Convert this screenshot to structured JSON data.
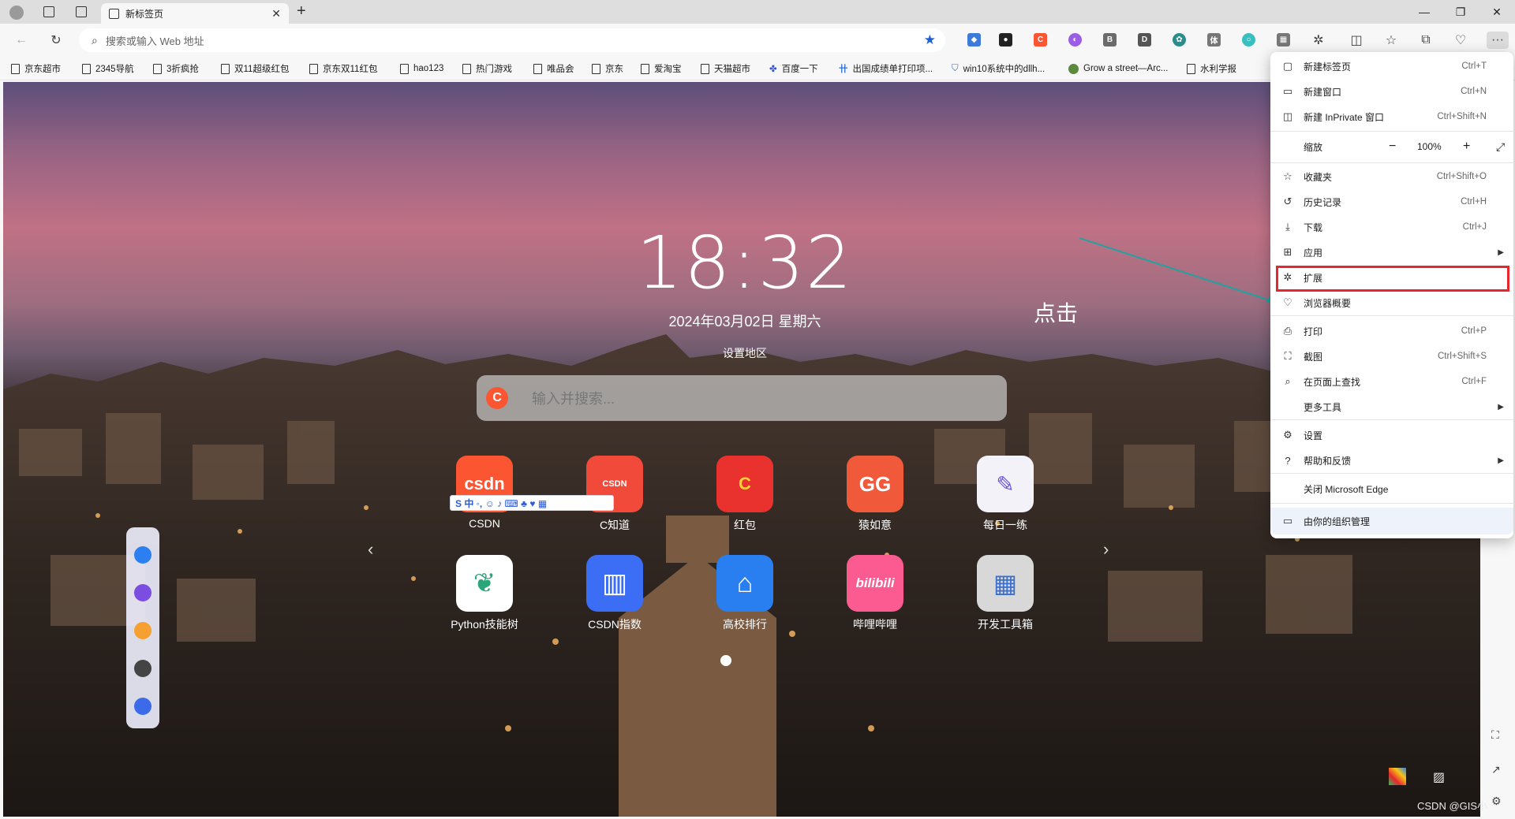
{
  "tab": {
    "title": "新标签页"
  },
  "address": {
    "placeholder": "搜索或输入 Web 地址"
  },
  "favorites": [
    "京东超市",
    "2345导航",
    "3折疯抢",
    "双11超级红包",
    "京东双11红包",
    "hao123",
    "热门游戏",
    "唯品会",
    "京东",
    "爱淘宝",
    "天猫超市",
    "百度一下",
    "出国成绩单打印项...",
    "win10系统中的dllh...",
    "Grow a street—Arc...",
    "水利学报"
  ],
  "extensions": [
    {
      "label": "C",
      "color": "#fc5531"
    },
    {
      "label": "B",
      "color": "#6b6b6b"
    },
    {
      "label": "D",
      "color": "#555555"
    },
    {
      "label": "体",
      "color": "#777777"
    }
  ],
  "ntp": {
    "time": "18:32",
    "date": "2024年03月02日   星期六",
    "region": "设置地区",
    "search_placeholder": "输入并搜索...",
    "search_logo": "C",
    "apps": [
      {
        "label": "CSDN",
        "icon_text": "csdn",
        "color": "#fc5531"
      },
      {
        "label": "C知道",
        "icon_text": "CSDN",
        "color": "#f24a3a"
      },
      {
        "label": "红包",
        "icon_text": "C",
        "color": "#e9322e"
      },
      {
        "label": "猿如意",
        "icon_text": "GG",
        "color": "#f05a3a"
      },
      {
        "label": "每日一练",
        "icon_text": "✎",
        "color": "#f2f2f8"
      },
      {
        "label": "Python技能树",
        "icon_text": "❦",
        "color": "#ffffff"
      },
      {
        "label": "CSDN指数",
        "icon_text": "▥",
        "color": "#3b6df5"
      },
      {
        "label": "高校排行",
        "icon_text": "⌂",
        "color": "#2a7ff0"
      },
      {
        "label": "哔哩哔哩",
        "icon_text": "bilibili",
        "color": "#fb5b91"
      },
      {
        "label": "开发工具箱",
        "icon_text": "▦",
        "color": "#d8d8d8"
      }
    ],
    "ime_bar": "S 中 ◦, ☺ ♪ ⌨ ♣ ♥ ▦"
  },
  "menu": {
    "items": [
      {
        "label": "新建标签页",
        "shortcut": "Ctrl+T",
        "icon": "new-tab-icon",
        "glyph": "▢"
      },
      {
        "label": "新建窗口",
        "shortcut": "Ctrl+N",
        "icon": "new-window-icon",
        "glyph": "▭"
      },
      {
        "label": "新建 InPrivate 窗口",
        "shortcut": "Ctrl+Shift+N",
        "icon": "inprivate-icon",
        "glyph": "◫"
      },
      {
        "label": "缩放",
        "shortcut": "",
        "icon": "zoom-icon",
        "glyph": ""
      },
      {
        "label": "收藏夹",
        "shortcut": "Ctrl+Shift+O",
        "icon": "favorites-icon",
        "glyph": "☆"
      },
      {
        "label": "历史记录",
        "shortcut": "Ctrl+H",
        "icon": "history-icon",
        "glyph": "↺"
      },
      {
        "label": "下载",
        "shortcut": "Ctrl+J",
        "icon": "download-icon",
        "glyph": "⤓"
      },
      {
        "label": "应用",
        "shortcut": "",
        "icon": "apps-icon",
        "glyph": "⊞"
      },
      {
        "label": "扩展",
        "shortcut": "",
        "icon": "extensions-icon",
        "glyph": "✲"
      },
      {
        "label": "浏览器概要",
        "shortcut": "",
        "icon": "browser-essentials-icon",
        "glyph": "♡"
      },
      {
        "label": "打印",
        "shortcut": "Ctrl+P",
        "icon": "print-icon",
        "glyph": "⎙"
      },
      {
        "label": "截图",
        "shortcut": "Ctrl+Shift+S",
        "icon": "screenshot-icon",
        "glyph": "⛶"
      },
      {
        "label": "在页面上查找",
        "shortcut": "Ctrl+F",
        "icon": "find-icon",
        "glyph": "⌕"
      },
      {
        "label": "更多工具",
        "shortcut": "",
        "icon": "more-tools-icon",
        "glyph": ""
      },
      {
        "label": "设置",
        "shortcut": "",
        "icon": "settings-icon",
        "glyph": "⚙"
      },
      {
        "label": "帮助和反馈",
        "shortcut": "",
        "icon": "help-icon",
        "glyph": "?"
      },
      {
        "label": "关闭 Microsoft Edge",
        "shortcut": "",
        "icon": "",
        "glyph": ""
      },
      {
        "label": "由你的组织管理",
        "shortcut": "",
        "icon": "managed-icon",
        "glyph": "▭"
      }
    ],
    "zoom_value": "100%"
  },
  "annotation": "点击",
  "watermark": "CSDN @GIS小"
}
